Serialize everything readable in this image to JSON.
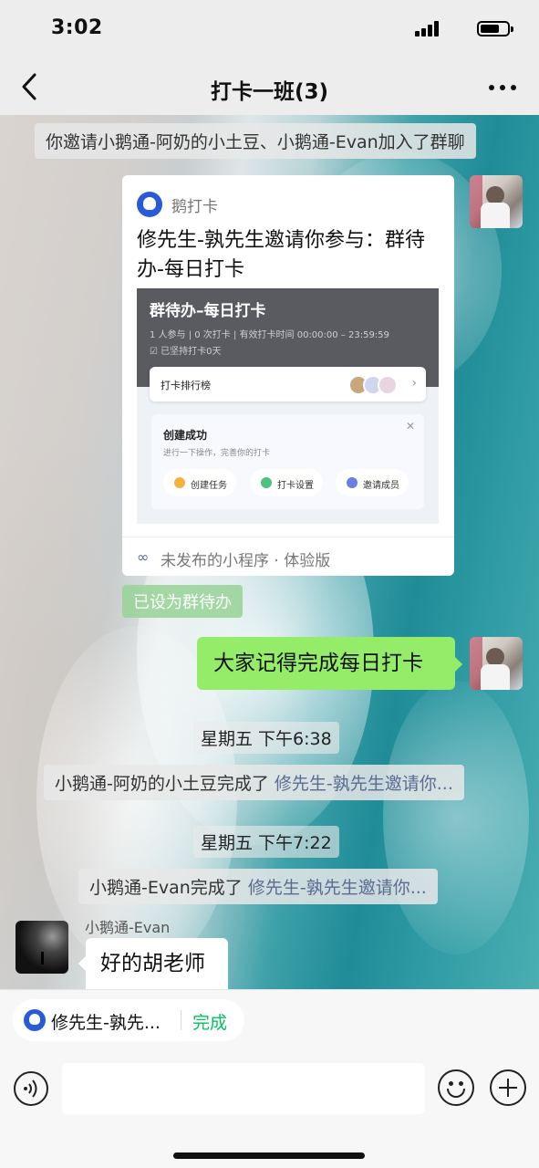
{
  "status_bar": {
    "time": "3:02"
  },
  "nav": {
    "title": "打卡一班(3)"
  },
  "messages": {
    "system_invite": "你邀请小鹅通-阿奶的小土豆、小鹅通-Evan加入了群聊",
    "card": {
      "app_name": "鹅打卡",
      "title": "修先生-孰先生邀请你参与：群待办-每日打卡",
      "preview": {
        "title": "群待办–每日打卡",
        "stats": "1 人参与  |  0 次打卡  |  有效打卡时间 00:00:00 – 23:59:59",
        "streak": "☑ 已坚持打卡0天",
        "rank_label": "打卡排行榜",
        "success_title": "创建成功",
        "success_sub": "进行一下操作，完善你的打卡",
        "actions": [
          "创建任务",
          "打卡设置",
          "邀请成员"
        ]
      },
      "footer": "未发布的小程序 · 体验版"
    },
    "todo_tag": "已设为群待办",
    "my_bubble": "大家记得完成每日打卡",
    "ts1": "星期五 下午6:38",
    "sys_done1_prefix": "小鹅通-阿奶的小土豆完成了",
    "sys_done1_link": "修先生-孰先生邀请你...",
    "ts2": "星期五 下午7:22",
    "sys_done2_prefix": "小鹅通-Evan完成了",
    "sys_done2_link": "修先生-孰先生邀请你...",
    "other_sender": "小鹅通-Evan",
    "other_bubble": "好的胡老师"
  },
  "bottom": {
    "todo_chip_text": "修先生-孰先...",
    "todo_chip_done": "完成"
  },
  "colors": {
    "accent_green": "#07c160",
    "bubble_green": "#95ec69",
    "link": "#576b95"
  }
}
